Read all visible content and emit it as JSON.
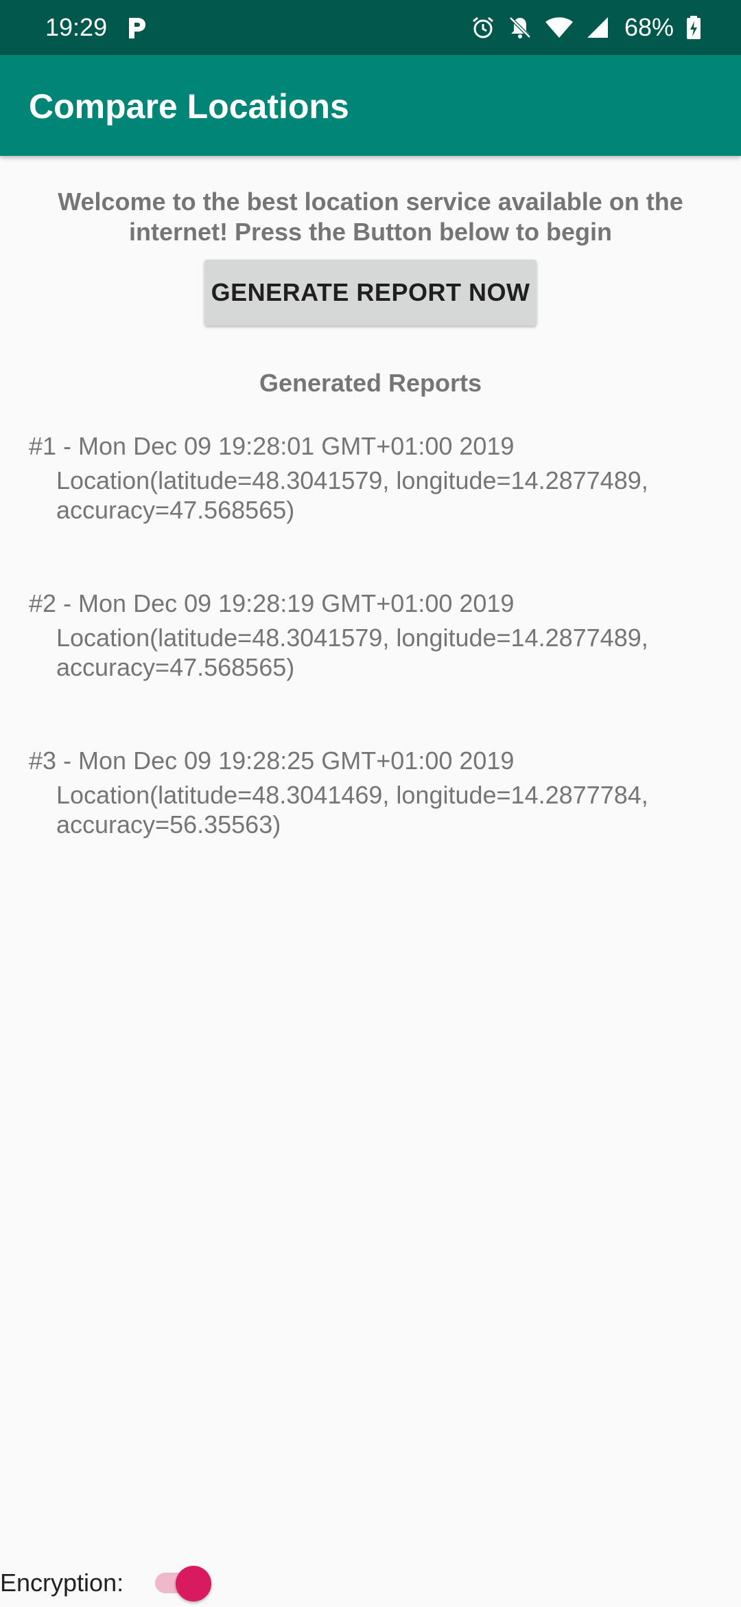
{
  "status_bar": {
    "time": "19:29",
    "battery": "68%",
    "icons": [
      "parking-icon",
      "alarm-icon",
      "notifications-off-icon",
      "wifi-icon",
      "signal-icon",
      "battery-icon"
    ]
  },
  "app_bar": {
    "title": "Compare Locations",
    "color": "#008577",
    "status_color": "#00574b"
  },
  "main": {
    "welcome": "Welcome to the best location service available on the internet! Press the Button below to begin",
    "generate_button": "GENERATE REPORT NOW",
    "reports_heading": "Generated Reports",
    "reports": [
      {
        "title": "#1 - Mon Dec 09 19:28:01 GMT+01:00 2019",
        "location": "Location(latitude=48.3041579, longitude=14.2877489, accuracy=47.568565)"
      },
      {
        "title": "#2 - Mon Dec 09 19:28:19 GMT+01:00 2019",
        "location": "Location(latitude=48.3041579, longitude=14.2877489, accuracy=47.568565)"
      },
      {
        "title": "#3 - Mon Dec 09 19:28:25 GMT+01:00 2019",
        "location": "Location(latitude=48.3041469, longitude=14.2877784, accuracy=56.35563)"
      }
    ]
  },
  "footer": {
    "encryption_label": "Encryption:",
    "encryption_enabled": true,
    "accent_color": "#d81b60"
  }
}
